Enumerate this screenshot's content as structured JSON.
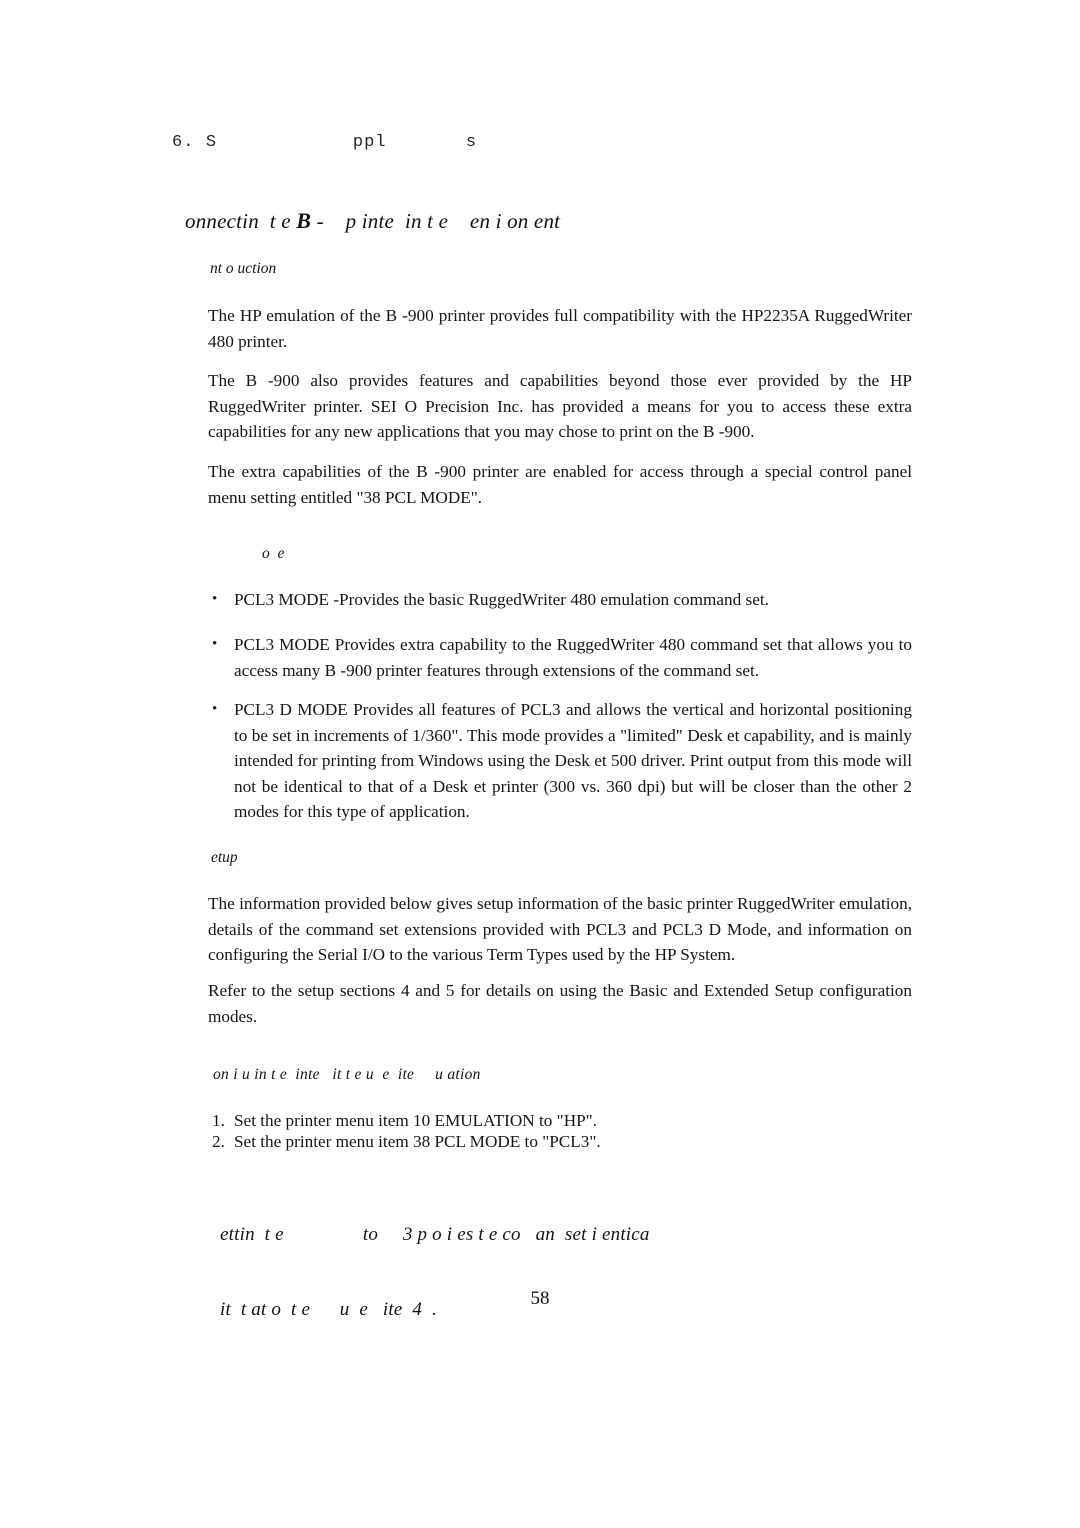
{
  "page": {
    "background_color": "#ffffff",
    "text_color": "#151515",
    "folio": "58"
  },
  "running_header": {
    "text": "6. S            ppl       s"
  },
  "chapter": {
    "title_before": "onnectin  t e ",
    "title_b": "B",
    "title_after": " -    p inte  in t e    en i on ent"
  },
  "headings": {
    "introduction": "nt o uction",
    "modes": "o  e",
    "setup": "etup",
    "configuring": "on i u in t e  inte   it t e u  e  ite     u ation"
  },
  "paragraphs": {
    "p1": "The HP emulation of the B  -900 printer provides full compatibility with the HP2235A RuggedWriter 480 printer.",
    "p2": "The B  -900 also provides features and capabilities beyond those ever provided by the HP RuggedWriter printer.  SEI  O Precision Inc.  has provided a means for you to access these extra capabilities for any new applications that you may chose to print on the B  -900.",
    "p3": "The extra capabilities of the B  -900 printer are enabled for access through a special control panel menu setting entitled \"38 PCL MODE\".",
    "p6": "The information provided below gives setup information of the basic printer RuggedWriter emulation, details of the command set extensions provided with PCL3   and PCL3 D Mode, and information on configuring the Serial I/O to the various Term Types used by the HP System.",
    "p7": "Refer to the setup sections 4 and 5 for details on using the Basic and Extended Setup configuration modes."
  },
  "bullets": {
    "marker": "•",
    "items": [
      "PCL3 MODE -Provides the basic RuggedWriter 480 emulation command set.",
      "PCL3   MODE Provides extra capability to the RuggedWriter 480 command set that allows you to access many B  -900 printer features through extensions of the command set.",
      "PCL3 D MODE Provides all features of PCL3   and allows the vertical and horizontal positioning to be set in increments of 1/360\".  This mode provides a \"limited\" Desk et capability, and is mainly intended for printing from Windows using the Desk et 500 driver.  Print output from this mode will not be identical to that of a Desk et printer (300 vs. 360 dpi) but will be closer than the other 2 modes for this type of application."
    ]
  },
  "numbered_list": {
    "item1_number": "1.",
    "item1_text": "Set the printer menu item 10 EMULATION to \"HP\".",
    "item2_number": "2.",
    "item2_text": "Set the printer menu item 38 PCL MODE to \"PCL3\"."
  },
  "closing_note": {
    "line1": "ettin  t e                to     3 p o i es t e co   an  set i entica",
    "line2": "it  t at o  t e      u  e   ite  4  ."
  }
}
